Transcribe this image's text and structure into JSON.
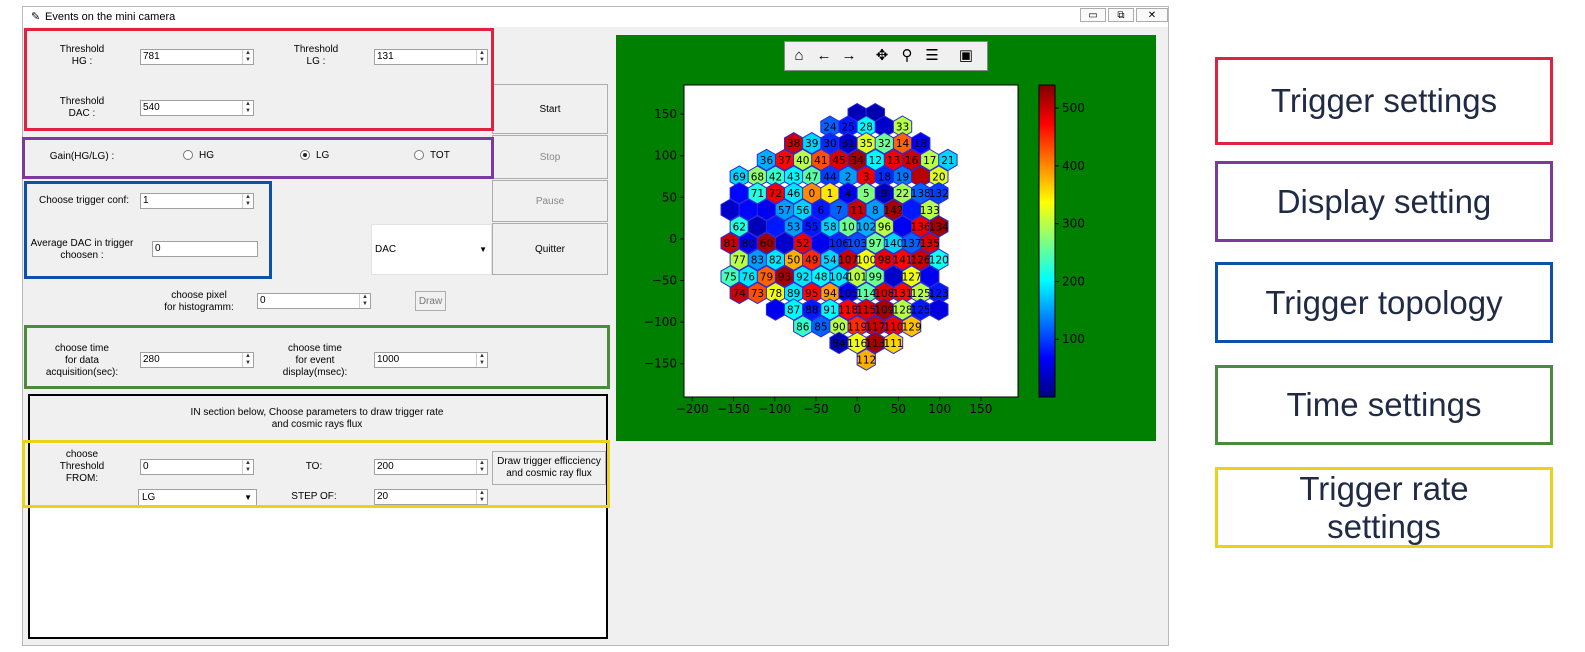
{
  "window": {
    "title": "Events on the mini camera",
    "min_label": "▭",
    "max_label": "⧉",
    "close_label": "✕"
  },
  "trigger": {
    "hg_label": "Threshold\nHG :",
    "hg_value": "781",
    "lg_label": "Threshold\nLG :",
    "lg_value": "131",
    "dac_label": "Threshold\nDAC :",
    "dac_value": "540"
  },
  "gain": {
    "label": "Gain(HG/LG) :",
    "options": [
      "HG",
      "LG",
      "TOT"
    ],
    "selected": "LG"
  },
  "topology": {
    "conf_label": "Choose trigger conf:",
    "conf_value": "1",
    "avg_label": "Average DAC in trigger\nchoosen :",
    "avg_value": "0",
    "mode_value": "DAC"
  },
  "controls": {
    "start": "Start",
    "stop": "Stop",
    "pause": "Pause",
    "quit": "Quitter"
  },
  "histogram": {
    "label": "choose pixel\nfor histogramm:",
    "value": "0",
    "draw": "Draw"
  },
  "time": {
    "acq_label": "choose time\nfor data\nacquisition(sec):",
    "acq_value": "280",
    "disp_label": "choose time\nfor event\ndisplay(msec):",
    "disp_value": "1000"
  },
  "rate": {
    "info": "IN section below, Choose parameters to draw trigger rate\nand cosmic rays flux",
    "from_label": "choose\nThreshold\nFROM:",
    "from_value": "0",
    "to_label": "TO:",
    "to_value": "200",
    "gain_value": "LG",
    "step_label": "STEP OF:",
    "step_value": "20",
    "draw_button": "Draw trigger efficciency\nand cosmic ray flux"
  },
  "toolbar": {
    "icons": [
      "home-icon",
      "back-arrow-icon",
      "forward-arrow-icon",
      "pan-icon",
      "zoom-icon",
      "configure-icon",
      "save-icon"
    ]
  },
  "colors": {
    "trigger": "#e0223f",
    "display": "#7b3a9e",
    "topology": "#0d52a8",
    "time": "#4a8c3a",
    "rate": "#e8d21a",
    "plot_bg": "#008000"
  },
  "legend": [
    {
      "label": "Trigger settings",
      "color": "#e0223f"
    },
    {
      "label": "Display setting",
      "color": "#7b3a9e"
    },
    {
      "label": "Trigger topology",
      "color": "#0d52a8"
    },
    {
      "label": "Time settings",
      "color": "#4a8c3a"
    },
    {
      "label": "Trigger rate\nsettings",
      "color": "#e8d21a"
    }
  ],
  "chart_data": {
    "type": "heatmap",
    "xlim": [
      -210,
      195
    ],
    "ylim": [
      -190,
      185
    ],
    "xticks": [
      -200,
      -150,
      -100,
      -50,
      0,
      50,
      100,
      150
    ],
    "xtick_labels": [
      "−200",
      "−150",
      "−100",
      "−50",
      "0",
      "50",
      "100",
      "150"
    ],
    "yticks": [
      -150,
      -100,
      -50,
      0,
      50,
      100,
      150
    ],
    "ytick_labels": [
      "−150",
      "−100",
      "−50",
      "0",
      "50",
      "100",
      "150"
    ],
    "colorbar_ticks": [
      100,
      200,
      300,
      400,
      500
    ],
    "colorbar_range": [
      0,
      540
    ],
    "pixels": [
      {
        "x": 0,
        "y": 150,
        "n": "",
        "v": 30
      },
      {
        "x": 22,
        "y": 150,
        "n": "",
        "v": 25
      },
      {
        "x": -33,
        "y": 135,
        "n": "24",
        "v": 120
      },
      {
        "x": -11,
        "y": 135,
        "n": "25",
        "v": 80
      },
      {
        "x": 11,
        "y": 135,
        "n": "28",
        "v": 200
      },
      {
        "x": 33,
        "y": 135,
        "n": "",
        "v": 40
      },
      {
        "x": 55,
        "y": 135,
        "n": "33",
        "v": 300
      },
      {
        "x": -77,
        "y": 115,
        "n": "38",
        "v": 500
      },
      {
        "x": -55,
        "y": 115,
        "n": "39",
        "v": 180
      },
      {
        "x": -33,
        "y": 115,
        "n": "30",
        "v": 90
      },
      {
        "x": -11,
        "y": 115,
        "n": "31",
        "v": 40
      },
      {
        "x": 11,
        "y": 115,
        "n": "35",
        "v": 320
      },
      {
        "x": 33,
        "y": 115,
        "n": "32",
        "v": 260
      },
      {
        "x": 55,
        "y": 115,
        "n": "14",
        "v": 420
      },
      {
        "x": 77,
        "y": 115,
        "n": "18",
        "v": 60
      },
      {
        "x": -110,
        "y": 95,
        "n": "36",
        "v": 160
      },
      {
        "x": -88,
        "y": 95,
        "n": "37",
        "v": 470
      },
      {
        "x": -66,
        "y": 95,
        "n": "40",
        "v": 300
      },
      {
        "x": -44,
        "y": 95,
        "n": "41",
        "v": 430
      },
      {
        "x": -22,
        "y": 95,
        "n": "45",
        "v": 490
      },
      {
        "x": 0,
        "y": 95,
        "n": "34",
        "v": 520
      },
      {
        "x": 22,
        "y": 95,
        "n": "12",
        "v": 200
      },
      {
        "x": 44,
        "y": 95,
        "n": "13",
        "v": 480
      },
      {
        "x": 66,
        "y": 95,
        "n": "16",
        "v": 500
      },
      {
        "x": 88,
        "y": 95,
        "n": "17",
        "v": 300
      },
      {
        "x": 110,
        "y": 95,
        "n": "21",
        "v": 180
      },
      {
        "x": -143,
        "y": 75,
        "n": "69",
        "v": 180
      },
      {
        "x": -121,
        "y": 75,
        "n": "68",
        "v": 280
      },
      {
        "x": -99,
        "y": 75,
        "n": "42",
        "v": 230
      },
      {
        "x": -77,
        "y": 75,
        "n": "43",
        "v": 200
      },
      {
        "x": -55,
        "y": 75,
        "n": "47",
        "v": 250
      },
      {
        "x": -33,
        "y": 75,
        "n": "44",
        "v": 100
      },
      {
        "x": -11,
        "y": 75,
        "n": "2",
        "v": 150
      },
      {
        "x": 11,
        "y": 75,
        "n": "3",
        "v": 480
      },
      {
        "x": 33,
        "y": 75,
        "n": "18",
        "v": 90
      },
      {
        "x": 55,
        "y": 75,
        "n": "19",
        "v": 130
      },
      {
        "x": 77,
        "y": 75,
        "n": "",
        "v": 510
      },
      {
        "x": 99,
        "y": 75,
        "n": "20",
        "v": 320
      },
      {
        "x": -143,
        "y": 55,
        "n": "",
        "v": 70
      },
      {
        "x": -121,
        "y": 55,
        "n": "71",
        "v": 220
      },
      {
        "x": -99,
        "y": 55,
        "n": "72",
        "v": 480
      },
      {
        "x": -77,
        "y": 55,
        "n": "46",
        "v": 190
      },
      {
        "x": -55,
        "y": 55,
        "n": "0",
        "v": 400
      },
      {
        "x": -33,
        "y": 55,
        "n": "1",
        "v": 350
      },
      {
        "x": -11,
        "y": 55,
        "n": "4",
        "v": 60
      },
      {
        "x": 11,
        "y": 55,
        "n": "5",
        "v": 270
      },
      {
        "x": 33,
        "y": 55,
        "n": "9",
        "v": 30
      },
      {
        "x": 55,
        "y": 55,
        "n": "22",
        "v": 290
      },
      {
        "x": 77,
        "y": 55,
        "n": "138",
        "v": 120
      },
      {
        "x": 99,
        "y": 55,
        "n": "132",
        "v": 100
      },
      {
        "x": -154,
        "y": 35,
        "n": "",
        "v": 40
      },
      {
        "x": -132,
        "y": 35,
        "n": "",
        "v": 70
      },
      {
        "x": -110,
        "y": 35,
        "n": "",
        "v": 60
      },
      {
        "x": -88,
        "y": 35,
        "n": "57",
        "v": 150
      },
      {
        "x": -66,
        "y": 35,
        "n": "56",
        "v": 180
      },
      {
        "x": -44,
        "y": 35,
        "n": "6",
        "v": 80
      },
      {
        "x": -22,
        "y": 35,
        "n": "7",
        "v": 120
      },
      {
        "x": 0,
        "y": 35,
        "n": "11",
        "v": 500
      },
      {
        "x": 22,
        "y": 35,
        "n": "8",
        "v": 150
      },
      {
        "x": 44,
        "y": 35,
        "n": "142",
        "v": 520
      },
      {
        "x": 66,
        "y": 35,
        "n": "",
        "v": 80
      },
      {
        "x": 88,
        "y": 35,
        "n": "133",
        "v": 300
      },
      {
        "x": -143,
        "y": 15,
        "n": "62",
        "v": 220
      },
      {
        "x": -121,
        "y": 15,
        "n": "",
        "v": 30
      },
      {
        "x": -99,
        "y": 15,
        "n": "",
        "v": 80
      },
      {
        "x": -77,
        "y": 15,
        "n": "53",
        "v": 150
      },
      {
        "x": -55,
        "y": 15,
        "n": "55",
        "v": 80
      },
      {
        "x": -33,
        "y": 15,
        "n": "58",
        "v": 180
      },
      {
        "x": -11,
        "y": 15,
        "n": "10",
        "v": 260
      },
      {
        "x": 11,
        "y": 15,
        "n": "102",
        "v": 160
      },
      {
        "x": 33,
        "y": 15,
        "n": "96",
        "v": 300
      },
      {
        "x": 55,
        "y": 15,
        "n": "",
        "v": 60
      },
      {
        "x": 77,
        "y": 15,
        "n": "136",
        "v": 480
      },
      {
        "x": 99,
        "y": 15,
        "n": "134",
        "v": 520
      },
      {
        "x": -154,
        "y": -5,
        "n": "81",
        "v": 500
      },
      {
        "x": -132,
        "y": -5,
        "n": "80",
        "v": 60
      },
      {
        "x": -110,
        "y": -5,
        "n": "60",
        "v": 520
      },
      {
        "x": -88,
        "y": -5,
        "n": "",
        "v": 40
      },
      {
        "x": -66,
        "y": -5,
        "n": "52",
        "v": 480
      },
      {
        "x": -44,
        "y": -5,
        "n": "",
        "v": 60
      },
      {
        "x": -22,
        "y": -5,
        "n": "106",
        "v": 90
      },
      {
        "x": 0,
        "y": -5,
        "n": "103",
        "v": 110
      },
      {
        "x": 22,
        "y": -5,
        "n": "97",
        "v": 260
      },
      {
        "x": 44,
        "y": -5,
        "n": "140",
        "v": 180
      },
      {
        "x": 66,
        "y": -5,
        "n": "137",
        "v": 120
      },
      {
        "x": 88,
        "y": -5,
        "n": "135",
        "v": 490
      },
      {
        "x": -143,
        "y": -25,
        "n": "77",
        "v": 300
      },
      {
        "x": -121,
        "y": -25,
        "n": "83",
        "v": 150
      },
      {
        "x": -99,
        "y": -25,
        "n": "82",
        "v": 190
      },
      {
        "x": -77,
        "y": -25,
        "n": "50",
        "v": 380
      },
      {
        "x": -55,
        "y": -25,
        "n": "49",
        "v": 450
      },
      {
        "x": -33,
        "y": -25,
        "n": "54",
        "v": 180
      },
      {
        "x": -11,
        "y": -25,
        "n": "107",
        "v": 500
      },
      {
        "x": 11,
        "y": -25,
        "n": "100",
        "v": 330
      },
      {
        "x": 33,
        "y": -25,
        "n": "98",
        "v": 480
      },
      {
        "x": 55,
        "y": -25,
        "n": "141",
        "v": 470
      },
      {
        "x": 77,
        "y": -25,
        "n": "126",
        "v": 500
      },
      {
        "x": 99,
        "y": -25,
        "n": "120",
        "v": 210
      },
      {
        "x": -154,
        "y": -45,
        "n": "75",
        "v": 240
      },
      {
        "x": -132,
        "y": -45,
        "n": "76",
        "v": 190
      },
      {
        "x": -110,
        "y": -45,
        "n": "79",
        "v": 420
      },
      {
        "x": -88,
        "y": -45,
        "n": "93",
        "v": 520
      },
      {
        "x": -66,
        "y": -45,
        "n": "92",
        "v": 190
      },
      {
        "x": -44,
        "y": -45,
        "n": "48",
        "v": 200
      },
      {
        "x": -22,
        "y": -45,
        "n": "104",
        "v": 190
      },
      {
        "x": 0,
        "y": -45,
        "n": "101",
        "v": 300
      },
      {
        "x": 22,
        "y": -45,
        "n": "99",
        "v": 260
      },
      {
        "x": 44,
        "y": -45,
        "n": "",
        "v": 40
      },
      {
        "x": 66,
        "y": -45,
        "n": "127",
        "v": 330
      },
      {
        "x": 88,
        "y": -45,
        "n": "",
        "v": 60
      },
      {
        "x": -143,
        "y": -65,
        "n": "74",
        "v": 500
      },
      {
        "x": -121,
        "y": -65,
        "n": "73",
        "v": 430
      },
      {
        "x": -99,
        "y": -65,
        "n": "78",
        "v": 330
      },
      {
        "x": -77,
        "y": -65,
        "n": "89",
        "v": 190
      },
      {
        "x": -55,
        "y": -65,
        "n": "95",
        "v": 470
      },
      {
        "x": -33,
        "y": -65,
        "n": "94",
        "v": 390
      },
      {
        "x": -11,
        "y": -65,
        "n": "105",
        "v": 60
      },
      {
        "x": 11,
        "y": -65,
        "n": "114",
        "v": 250
      },
      {
        "x": 33,
        "y": -65,
        "n": "108",
        "v": 490
      },
      {
        "x": 55,
        "y": -65,
        "n": "131",
        "v": 470
      },
      {
        "x": 77,
        "y": -65,
        "n": "125",
        "v": 300
      },
      {
        "x": 99,
        "y": -65,
        "n": "123",
        "v": 80
      },
      {
        "x": -99,
        "y": -85,
        "n": "",
        "v": 60
      },
      {
        "x": -77,
        "y": -85,
        "n": "87",
        "v": 200
      },
      {
        "x": -55,
        "y": -85,
        "n": "88",
        "v": 80
      },
      {
        "x": -33,
        "y": -85,
        "n": "91",
        "v": 200
      },
      {
        "x": -11,
        "y": -85,
        "n": "118",
        "v": 470
      },
      {
        "x": 11,
        "y": -85,
        "n": "115",
        "v": 490
      },
      {
        "x": 33,
        "y": -85,
        "n": "109",
        "v": 520
      },
      {
        "x": 55,
        "y": -85,
        "n": "128",
        "v": 300
      },
      {
        "x": 77,
        "y": -85,
        "n": "125",
        "v": 80
      },
      {
        "x": 99,
        "y": -85,
        "n": "",
        "v": 50
      },
      {
        "x": -66,
        "y": -105,
        "n": "86",
        "v": 230
      },
      {
        "x": -44,
        "y": -105,
        "n": "85",
        "v": 120
      },
      {
        "x": -22,
        "y": -105,
        "n": "90",
        "v": 300
      },
      {
        "x": 0,
        "y": -105,
        "n": "119",
        "v": 450
      },
      {
        "x": 22,
        "y": -105,
        "n": "117",
        "v": 500
      },
      {
        "x": 44,
        "y": -105,
        "n": "110",
        "v": 480
      },
      {
        "x": 66,
        "y": -105,
        "n": "129",
        "v": 370
      },
      {
        "x": -22,
        "y": -125,
        "n": "84",
        "v": 30
      },
      {
        "x": 0,
        "y": -125,
        "n": "116",
        "v": 330
      },
      {
        "x": 22,
        "y": -125,
        "n": "113",
        "v": 520
      },
      {
        "x": 44,
        "y": -125,
        "n": "111",
        "v": 360
      },
      {
        "x": 11,
        "y": -145,
        "n": "112",
        "v": 380
      }
    ]
  }
}
